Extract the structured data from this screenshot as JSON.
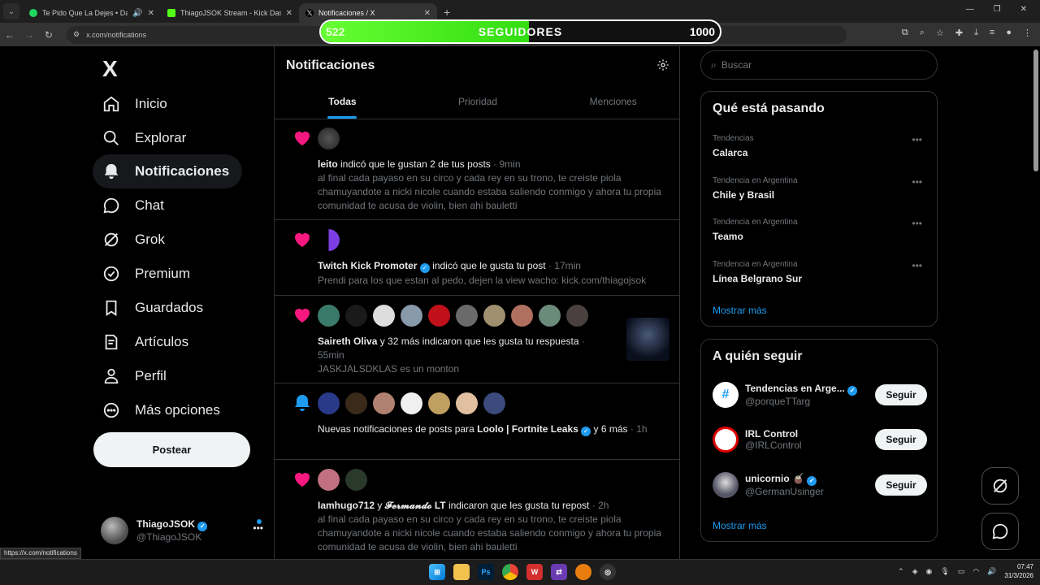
{
  "browser": {
    "tabs": [
      {
        "title": "Te Pido Que La Dejes • Dam",
        "favicon_color": "#1ed760",
        "active": false
      },
      {
        "title": "ThiagoJSOK Stream - Kick Dash",
        "favicon_color": "#53fc18",
        "active": false
      },
      {
        "title": "Notificaciones / X",
        "favicon_color": "#ffffff",
        "active": true
      }
    ],
    "url": "x.com/notifications",
    "status_url": "https://x.com/notifications"
  },
  "overlay": {
    "current": "522",
    "label": "SEGUIDORES",
    "goal": "1000",
    "progress": 0.522
  },
  "sidebar": {
    "logo": "X",
    "items": [
      {
        "label": "Inicio",
        "icon": "home-icon"
      },
      {
        "label": "Explorar",
        "icon": "search-icon"
      },
      {
        "label": "Notificaciones",
        "icon": "bell-icon",
        "selected": true
      },
      {
        "label": "Chat",
        "icon": "chat-bubble-icon"
      },
      {
        "label": "Grok",
        "icon": "grok-icon"
      },
      {
        "label": "Premium",
        "icon": "verified-badge-icon"
      },
      {
        "label": "Guardados",
        "icon": "bookmark-icon"
      },
      {
        "label": "Artículos",
        "icon": "article-icon"
      },
      {
        "label": "Perfil",
        "icon": "person-icon"
      },
      {
        "label": "Más opciones",
        "icon": "more-circle-icon"
      }
    ],
    "post_label": "Postear",
    "account": {
      "name": "ThiagoJSOK",
      "handle": "@ThiagoJSOK"
    }
  },
  "main": {
    "title": "Notificaciones",
    "tabs": [
      "Todas",
      "Prioridad",
      "Menciones"
    ],
    "notifications": [
      {
        "icon": "heart-icon",
        "actor": "leito",
        "action": "indicó que le gustan 2 de tus posts",
        "time": "· 9min",
        "body": "al final cada payaso en su circo y cada rey en su trono, te creiste piola chamuyandote a nicki nicole cuando estaba saliendo conmigo y ahora tu propia comunidad te acusa de violin, bien ahi bauletti"
      },
      {
        "icon": "heart-icon",
        "actor": "Twitch Kick Promoter",
        "action": "indicó que le gusta tu post",
        "time": "· 17min",
        "body": "Prendi para los que estan al pedo, dejen la view wacho: kick.com/thiagojsok"
      },
      {
        "icon": "heart-icon",
        "actor": "Saireth Oliva",
        "action": "y 32 más indicaron que les gusta tu respuesta",
        "time": "· 55min",
        "body": "JASKJALSDKLAS es un monton"
      },
      {
        "icon": "bell-icon",
        "actor": "Loolo | Fortnite Leaks",
        "prefix": "Nuevas notificaciones de posts para",
        "suffix": "y 6 más",
        "time": "· 1h"
      },
      {
        "icon": "heart-icon",
        "actor": "Iamhugo712",
        "actor2": "𝓕𝓮𝓻𝓶𝓪𝓷𝓭𝓸 LT",
        "action": "indicaron que les gusta tu repost",
        "time": "· 2h",
        "body": "al final cada payaso en su circo y cada rey en su trono, te creiste piola chamuyandote a nicki nicole cuando estaba saliendo conmigo y ahora tu propia comunidad te acusa de violin, bien ahi bauletti"
      }
    ]
  },
  "right": {
    "search_placeholder": "Buscar",
    "trending": {
      "title": "Qué está pasando",
      "items": [
        {
          "context": "Tendencias",
          "name": "Calarca"
        },
        {
          "context": "Tendencia en Argentina",
          "name": "Chile y Brasil"
        },
        {
          "context": "Tendencia en Argentina",
          "name": "Teamo"
        },
        {
          "context": "Tendencia en Argentina",
          "name": "Línea Belgrano Sur"
        }
      ],
      "more": "Mostrar más"
    },
    "who_to_follow": {
      "title": "A quién seguir",
      "items": [
        {
          "name": "Tendencias en Arge...",
          "handle": "@porqueTTarg",
          "button": "Seguir"
        },
        {
          "name": "IRL Control",
          "handle": "@IRLControl",
          "button": "Seguir"
        },
        {
          "name": "unicornio 🧉",
          "handle": "@GermanUsinger",
          "button": "Seguir"
        }
      ],
      "more": "Mostrar más"
    }
  },
  "taskbar": {
    "time": "07:47",
    "date": "31/3/2026"
  }
}
